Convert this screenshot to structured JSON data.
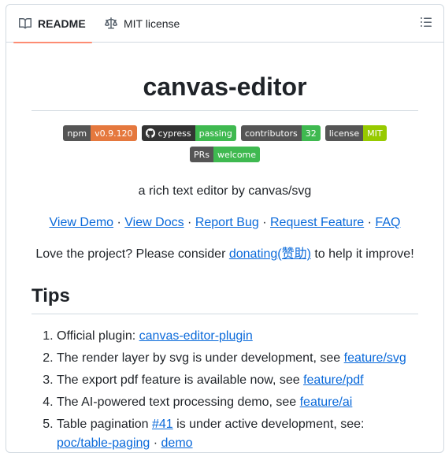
{
  "tabs": {
    "readme": "README",
    "license": "MIT license"
  },
  "title": "canvas-editor",
  "badges": [
    {
      "label": "npm",
      "value": "v0.9.120",
      "color": "#e05d44"
    },
    {
      "label": "cypress",
      "value": "passing",
      "color": "#4c1"
    },
    {
      "label": "contributors",
      "value": "32",
      "color": "#4c1"
    },
    {
      "label": "license",
      "value": "MIT",
      "color": "#97ca00"
    },
    {
      "label": "PRs",
      "value": "welcome",
      "color": "#4c1"
    }
  ],
  "tagline": "a rich text editor by canvas/svg",
  "nav_links": {
    "demo": "View Demo",
    "docs": "View Docs",
    "bug": "Report Bug",
    "feature": "Request Feature",
    "faq": "FAQ",
    "separator": "·"
  },
  "donate": {
    "before": "Love the project? Please consider ",
    "link": "donating(赞助)",
    "after": " to help it improve!"
  },
  "tips": {
    "heading": "Tips",
    "items": [
      {
        "text": "Official plugin: ",
        "link": "canvas-editor-plugin"
      },
      {
        "text": "The render layer by svg is under development, see ",
        "link": "feature/svg"
      },
      {
        "text": "The export pdf feature is available now, see ",
        "link": "feature/pdf"
      },
      {
        "text": "The AI-powered text processing demo, see ",
        "link": "feature/ai"
      },
      {
        "text": "Table pagination ",
        "link": "#41",
        "text2": " is under active development, see: ",
        "link2": "poc/table-paging",
        "sep": " · ",
        "link3": "demo"
      }
    ]
  }
}
